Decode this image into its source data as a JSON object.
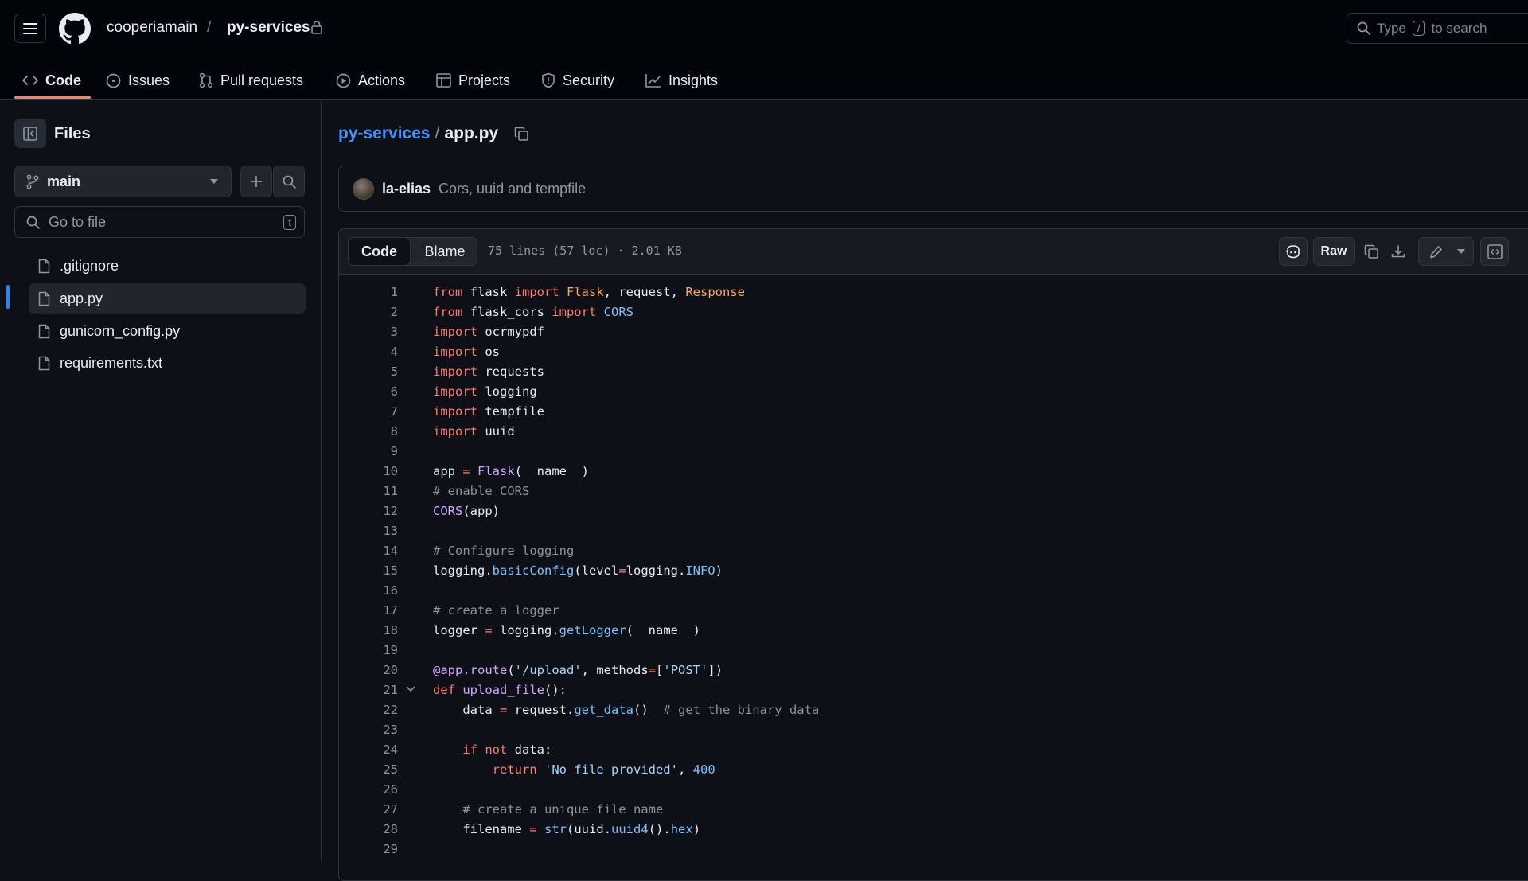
{
  "header": {
    "owner": "cooperiamain",
    "separator": "/",
    "repo": "py-services",
    "search": {
      "prefix": "Type",
      "key": "/",
      "suffix": "to search"
    },
    "tabs": [
      {
        "label": "Code",
        "icon": "code-icon",
        "active": true
      },
      {
        "label": "Issues",
        "icon": "issue-icon"
      },
      {
        "label": "Pull requests",
        "icon": "pull-request-icon"
      },
      {
        "label": "Actions",
        "icon": "play-icon"
      },
      {
        "label": "Projects",
        "icon": "table-icon"
      },
      {
        "label": "Security",
        "icon": "shield-icon"
      },
      {
        "label": "Insights",
        "icon": "graph-icon"
      }
    ]
  },
  "sidebar": {
    "title": "Files",
    "branch": "main",
    "goto_placeholder": "Go to file",
    "goto_key": "t",
    "files": [
      {
        "name": ".gitignore"
      },
      {
        "name": "app.py",
        "active": true
      },
      {
        "name": "gunicorn_config.py"
      },
      {
        "name": "requirements.txt"
      }
    ]
  },
  "main": {
    "path_repo": "py-services",
    "path_sep": "/",
    "path_file": "app.py",
    "commit": {
      "author": "la-elias",
      "message": "Cors, uuid and tempfile"
    },
    "view_tabs": {
      "code": "Code",
      "blame": "Blame"
    },
    "file_info": "75 lines (57 loc) · 2.01 KB",
    "raw_label": "Raw",
    "colors": {
      "accent": "#f78166",
      "link": "#4493f8",
      "keyword": "#ff7b72",
      "string": "#a5d6ff",
      "function": "#d2a8ff",
      "constant": "#79c0ff",
      "class": "#ffa657",
      "comment": "#8b949e"
    }
  },
  "code_lines": [
    "from flask import Flask, request, Response",
    "from flask_cors import CORS",
    "import ocrmypdf",
    "import os",
    "import requests",
    "import logging",
    "import tempfile",
    "import uuid",
    "",
    "app = Flask(__name__)",
    "# enable CORS",
    "CORS(app)",
    "",
    "# Configure logging",
    "logging.basicConfig(level=logging.INFO)",
    "",
    "# create a logger",
    "logger = logging.getLogger(__name__)",
    "",
    "@app.route('/upload', methods=['POST'])",
    "def upload_file():",
    "    data = request.get_data()  # get the binary data",
    "",
    "    if not data:",
    "        return 'No file provided', 400",
    "",
    "    # create a unique file name",
    "    filename = str(uuid.uuid4().hex)",
    ""
  ]
}
